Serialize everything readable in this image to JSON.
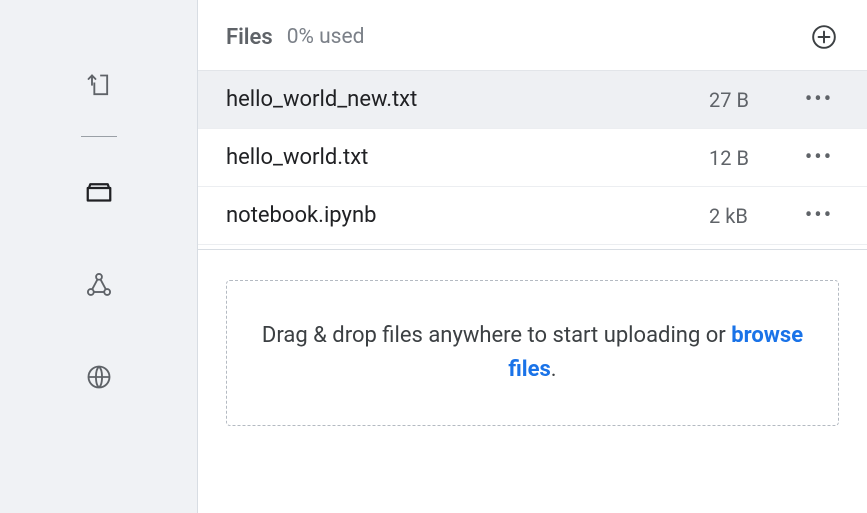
{
  "sidebar": {
    "items": [
      {
        "name": "upload-icon"
      },
      {
        "name": "folder-icon"
      },
      {
        "name": "share-icon"
      },
      {
        "name": "globe-icon"
      }
    ]
  },
  "header": {
    "title": "Files",
    "usage": "0% used"
  },
  "files": [
    {
      "name": "hello_world_new.txt",
      "size": "27 B",
      "selected": true
    },
    {
      "name": "hello_world.txt",
      "size": "12 B",
      "selected": false
    },
    {
      "name": "notebook.ipynb",
      "size": "2 kB",
      "selected": false
    }
  ],
  "dropzone": {
    "text_before": "Drag & drop files anywhere to start uploading or ",
    "link": "browse files",
    "text_after": "."
  }
}
